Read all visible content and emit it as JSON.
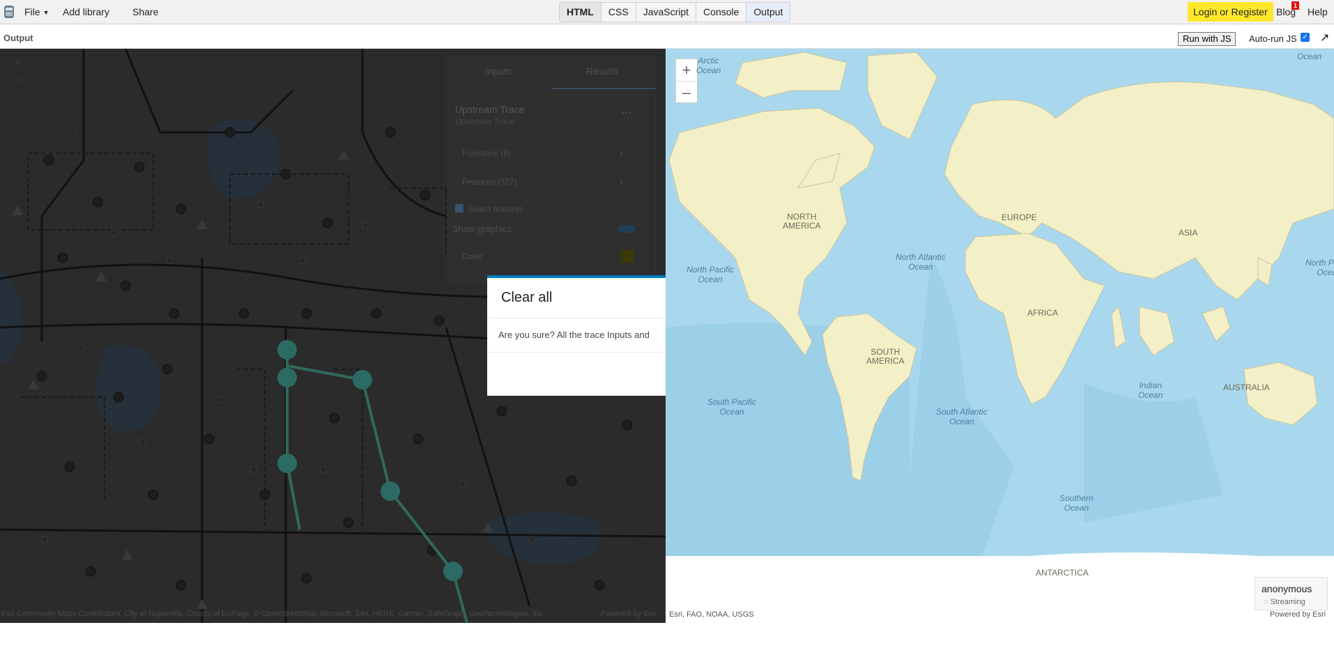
{
  "topbar": {
    "menu": [
      {
        "label": "File",
        "has_caret": true
      },
      {
        "label": "Add library"
      },
      {
        "label": "Share"
      }
    ],
    "tabs": [
      "HTML",
      "CSS",
      "JavaScript",
      "Console",
      "Output"
    ],
    "login_label": "Login or Register",
    "blog_label": "Blog",
    "blog_badge": "1",
    "help_label": "Help"
  },
  "outbar": {
    "title": "Output",
    "run_label": "Run with JS",
    "autorun_label": "Auto-run JS",
    "autorun_checked": true
  },
  "left_map": {
    "panel": {
      "tab_inputs": "Inputs",
      "tab_results": "Results",
      "trace_title": "Upstream Trace",
      "trace_subtitle": "Upstream Trace",
      "functions": "Functions (6)",
      "features": "Features (327)",
      "select_features": "Select features",
      "show_graphics": "Show graphics",
      "color": "Color"
    },
    "dialog": {
      "title": "Clear all",
      "body": "Are you sure? All the trace Inputs and"
    },
    "attribution": "Esri Community Maps Contributors, City of Naperville, County of DuPage, © OpenStreetMap, Microsoft, Esri, HERE, Garmin, SafeGraph, GeoTechnologies, Inc",
    "powered_by": "Powered by Esri"
  },
  "right_map": {
    "zoom_in": "+",
    "zoom_out": "–",
    "oceans": [
      {
        "text": "Arctic\nOcean"
      },
      {
        "text": "Ocean"
      },
      {
        "text": "North Atlantic\nOcean"
      },
      {
        "text": "North Pacific\nOcean"
      },
      {
        "text": "North Pacific\nOcean"
      },
      {
        "text": "South Pacific\nOcean"
      },
      {
        "text": "South Atlantic\nOcean"
      },
      {
        "text": "Indian\nOcean"
      },
      {
        "text": "Southern\nOcean"
      }
    ],
    "continents": [
      {
        "text": "NORTH\nAMERICA"
      },
      {
        "text": "EUROPE"
      },
      {
        "text": "ASIA"
      },
      {
        "text": "AFRICA"
      },
      {
        "text": "SOUTH\nAMERICA"
      },
      {
        "text": "AUSTRALIA"
      },
      {
        "text": "ANTARCTICA"
      }
    ],
    "attribution": "Esri, FAO, NOAA, USGS",
    "powered_by": "Powered by Esri",
    "user_name": "anonymous",
    "user_status": "Streaming"
  },
  "colors": {
    "login_bg": "#ffe82c",
    "dialog_accent": "#007ac2",
    "ocean": "#a8d8ee",
    "land": "#f3f0c8"
  }
}
